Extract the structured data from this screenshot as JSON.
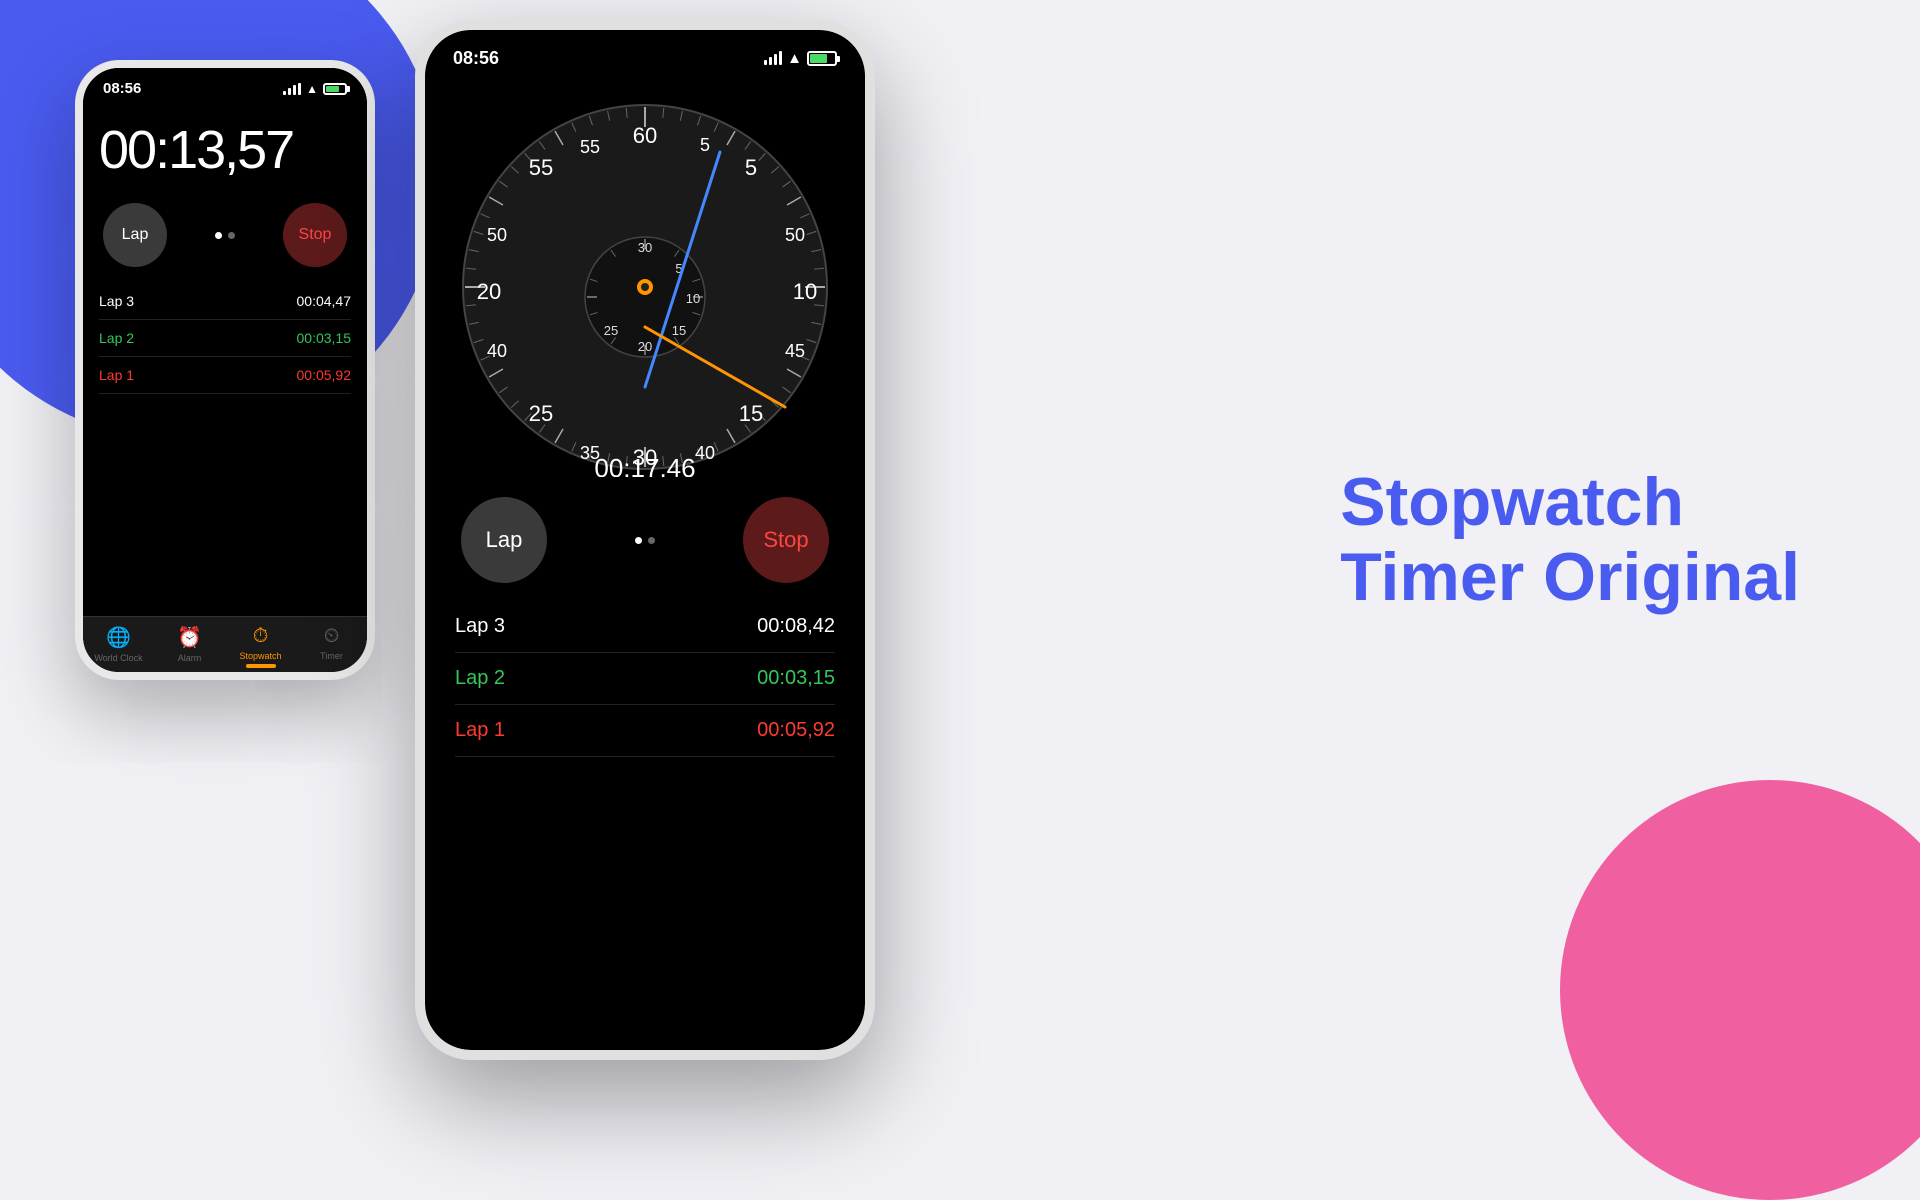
{
  "background": {
    "blue_color": "#4A5BF0",
    "pink_color": "#F060A0",
    "bg_color": "#f0f0f5"
  },
  "title": {
    "line1": "Stopwatch",
    "line2": "Timer Original"
  },
  "small_phone": {
    "status_time": "08:56",
    "timer": "00:13,57",
    "lap_button": "Lap",
    "stop_button": "Stop",
    "laps": [
      {
        "label": "Lap 3",
        "time": "00:04,47",
        "type": "normal"
      },
      {
        "label": "Lap 2",
        "time": "00:03,15",
        "type": "best"
      },
      {
        "label": "Lap 1",
        "time": "00:05,92",
        "type": "worst"
      }
    ],
    "tabs": [
      {
        "label": "World Clock",
        "icon": "🌐",
        "active": false
      },
      {
        "label": "Alarm",
        "icon": "⏰",
        "active": false
      },
      {
        "label": "Stopwatch",
        "icon": "⏱",
        "active": true
      },
      {
        "label": "Timer",
        "icon": "⏲",
        "active": false
      }
    ]
  },
  "large_phone": {
    "status_time": "08:56",
    "timer": "00:17,46",
    "lap_button": "Lap",
    "stop_button": "Stop",
    "laps": [
      {
        "label": "Lap 3",
        "time": "00:08,42",
        "type": "normal"
      },
      {
        "label": "Lap 2",
        "time": "00:03,15",
        "type": "best"
      },
      {
        "label": "Lap 1",
        "time": "00:05,92",
        "type": "worst"
      }
    ],
    "clock_numbers_outer": [
      "60",
      "5",
      "10",
      "15",
      "20",
      "25",
      "30",
      "35",
      "40",
      "45",
      "50",
      "55"
    ],
    "clock_numbers_inner": [
      "30",
      "5",
      "10",
      "15",
      "20",
      "25"
    ]
  }
}
